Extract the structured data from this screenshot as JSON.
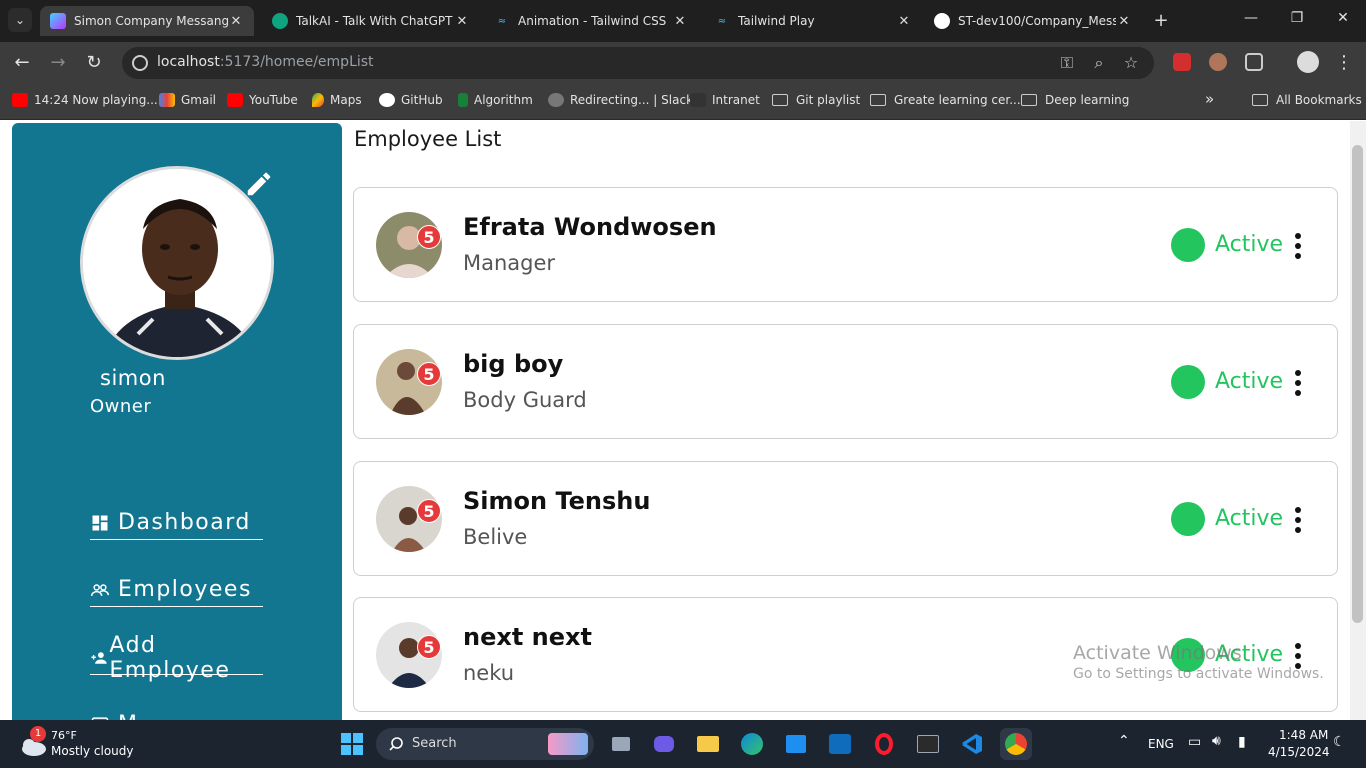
{
  "browser": {
    "tabs": [
      {
        "title": "Simon Company Messanger",
        "active": true
      },
      {
        "title": "TalkAI - Talk With ChatGPT",
        "active": false
      },
      {
        "title": "Animation - Tailwind CSS",
        "active": false
      },
      {
        "title": "Tailwind Play",
        "active": false
      },
      {
        "title": "ST-dev100/Company_Messa",
        "active": false
      }
    ],
    "url_host": "localhost",
    "url_path": ":5173/homee/empList",
    "bookmarks": [
      {
        "label": "14:24 Now playing...",
        "icon": "youtube-icon"
      },
      {
        "label": "Gmail",
        "icon": "gmail-icon"
      },
      {
        "label": "YouTube",
        "icon": "youtube-icon"
      },
      {
        "label": "Maps",
        "icon": "maps-icon"
      },
      {
        "label": "GitHub",
        "icon": "github-icon"
      },
      {
        "label": "Algorithm",
        "icon": "algorithm-icon"
      },
      {
        "label": "Redirecting... | Slack",
        "icon": "globe-icon"
      },
      {
        "label": "Intranet",
        "icon": "intranet-icon"
      },
      {
        "label": "Git playlist",
        "icon": "folder-icon"
      },
      {
        "label": "Greate learning cer...",
        "icon": "folder-icon"
      },
      {
        "label": "Deep learning",
        "icon": "folder-icon"
      }
    ],
    "all_bookmarks_label": "All Bookmarks",
    "overflow_label": "»"
  },
  "sidebar": {
    "user_name": "simon",
    "user_role": "Owner",
    "nav": [
      {
        "label": "Dashboard",
        "icon": "dashboard-icon"
      },
      {
        "label": "Employees",
        "icon": "employees-icon"
      },
      {
        "label": "Add Employee",
        "icon": "add-user-icon"
      },
      {
        "label": "M",
        "icon": "messages-icon"
      }
    ]
  },
  "main": {
    "title": "Employee List",
    "employees": [
      {
        "name": "Efrata Wondwosen",
        "role": "Manager",
        "badge": "5",
        "status": "Active"
      },
      {
        "name": "big boy",
        "role": "Body Guard",
        "badge": "5",
        "status": "Active"
      },
      {
        "name": "Simon Tenshu",
        "role": "Belive",
        "badge": "5",
        "status": "Active"
      },
      {
        "name": "next next",
        "role": "neku",
        "badge": "5",
        "status": "Active"
      }
    ]
  },
  "watermark": {
    "line1": "Activate Windows",
    "line2": "Go to Settings to activate Windows."
  },
  "taskbar": {
    "weather_badge": "1",
    "temperature": "76°F",
    "weather_text": "Mostly cloudy",
    "search_label": "Search",
    "language": "ENG",
    "time": "1:48 AM",
    "date": "4/15/2024"
  },
  "colors": {
    "sidebar": "#127691",
    "active_status": "#22c55e",
    "badge": "#e5393a"
  }
}
